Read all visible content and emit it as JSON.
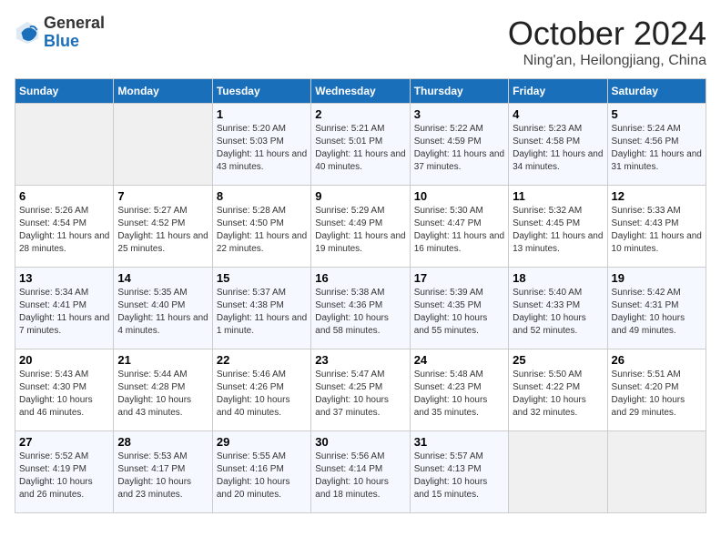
{
  "header": {
    "logo_general": "General",
    "logo_blue": "Blue",
    "month": "October 2024",
    "location": "Ning'an, Heilongjiang, China"
  },
  "days_of_week": [
    "Sunday",
    "Monday",
    "Tuesday",
    "Wednesday",
    "Thursday",
    "Friday",
    "Saturday"
  ],
  "weeks": [
    [
      {
        "day": "",
        "sunrise": "",
        "sunset": "",
        "daylight": ""
      },
      {
        "day": "",
        "sunrise": "",
        "sunset": "",
        "daylight": ""
      },
      {
        "day": "1",
        "sunrise": "Sunrise: 5:20 AM",
        "sunset": "Sunset: 5:03 PM",
        "daylight": "Daylight: 11 hours and 43 minutes."
      },
      {
        "day": "2",
        "sunrise": "Sunrise: 5:21 AM",
        "sunset": "Sunset: 5:01 PM",
        "daylight": "Daylight: 11 hours and 40 minutes."
      },
      {
        "day": "3",
        "sunrise": "Sunrise: 5:22 AM",
        "sunset": "Sunset: 4:59 PM",
        "daylight": "Daylight: 11 hours and 37 minutes."
      },
      {
        "day": "4",
        "sunrise": "Sunrise: 5:23 AM",
        "sunset": "Sunset: 4:58 PM",
        "daylight": "Daylight: 11 hours and 34 minutes."
      },
      {
        "day": "5",
        "sunrise": "Sunrise: 5:24 AM",
        "sunset": "Sunset: 4:56 PM",
        "daylight": "Daylight: 11 hours and 31 minutes."
      }
    ],
    [
      {
        "day": "6",
        "sunrise": "Sunrise: 5:26 AM",
        "sunset": "Sunset: 4:54 PM",
        "daylight": "Daylight: 11 hours and 28 minutes."
      },
      {
        "day": "7",
        "sunrise": "Sunrise: 5:27 AM",
        "sunset": "Sunset: 4:52 PM",
        "daylight": "Daylight: 11 hours and 25 minutes."
      },
      {
        "day": "8",
        "sunrise": "Sunrise: 5:28 AM",
        "sunset": "Sunset: 4:50 PM",
        "daylight": "Daylight: 11 hours and 22 minutes."
      },
      {
        "day": "9",
        "sunrise": "Sunrise: 5:29 AM",
        "sunset": "Sunset: 4:49 PM",
        "daylight": "Daylight: 11 hours and 19 minutes."
      },
      {
        "day": "10",
        "sunrise": "Sunrise: 5:30 AM",
        "sunset": "Sunset: 4:47 PM",
        "daylight": "Daylight: 11 hours and 16 minutes."
      },
      {
        "day": "11",
        "sunrise": "Sunrise: 5:32 AM",
        "sunset": "Sunset: 4:45 PM",
        "daylight": "Daylight: 11 hours and 13 minutes."
      },
      {
        "day": "12",
        "sunrise": "Sunrise: 5:33 AM",
        "sunset": "Sunset: 4:43 PM",
        "daylight": "Daylight: 11 hours and 10 minutes."
      }
    ],
    [
      {
        "day": "13",
        "sunrise": "Sunrise: 5:34 AM",
        "sunset": "Sunset: 4:41 PM",
        "daylight": "Daylight: 11 hours and 7 minutes."
      },
      {
        "day": "14",
        "sunrise": "Sunrise: 5:35 AM",
        "sunset": "Sunset: 4:40 PM",
        "daylight": "Daylight: 11 hours and 4 minutes."
      },
      {
        "day": "15",
        "sunrise": "Sunrise: 5:37 AM",
        "sunset": "Sunset: 4:38 PM",
        "daylight": "Daylight: 11 hours and 1 minute."
      },
      {
        "day": "16",
        "sunrise": "Sunrise: 5:38 AM",
        "sunset": "Sunset: 4:36 PM",
        "daylight": "Daylight: 10 hours and 58 minutes."
      },
      {
        "day": "17",
        "sunrise": "Sunrise: 5:39 AM",
        "sunset": "Sunset: 4:35 PM",
        "daylight": "Daylight: 10 hours and 55 minutes."
      },
      {
        "day": "18",
        "sunrise": "Sunrise: 5:40 AM",
        "sunset": "Sunset: 4:33 PM",
        "daylight": "Daylight: 10 hours and 52 minutes."
      },
      {
        "day": "19",
        "sunrise": "Sunrise: 5:42 AM",
        "sunset": "Sunset: 4:31 PM",
        "daylight": "Daylight: 10 hours and 49 minutes."
      }
    ],
    [
      {
        "day": "20",
        "sunrise": "Sunrise: 5:43 AM",
        "sunset": "Sunset: 4:30 PM",
        "daylight": "Daylight: 10 hours and 46 minutes."
      },
      {
        "day": "21",
        "sunrise": "Sunrise: 5:44 AM",
        "sunset": "Sunset: 4:28 PM",
        "daylight": "Daylight: 10 hours and 43 minutes."
      },
      {
        "day": "22",
        "sunrise": "Sunrise: 5:46 AM",
        "sunset": "Sunset: 4:26 PM",
        "daylight": "Daylight: 10 hours and 40 minutes."
      },
      {
        "day": "23",
        "sunrise": "Sunrise: 5:47 AM",
        "sunset": "Sunset: 4:25 PM",
        "daylight": "Daylight: 10 hours and 37 minutes."
      },
      {
        "day": "24",
        "sunrise": "Sunrise: 5:48 AM",
        "sunset": "Sunset: 4:23 PM",
        "daylight": "Daylight: 10 hours and 35 minutes."
      },
      {
        "day": "25",
        "sunrise": "Sunrise: 5:50 AM",
        "sunset": "Sunset: 4:22 PM",
        "daylight": "Daylight: 10 hours and 32 minutes."
      },
      {
        "day": "26",
        "sunrise": "Sunrise: 5:51 AM",
        "sunset": "Sunset: 4:20 PM",
        "daylight": "Daylight: 10 hours and 29 minutes."
      }
    ],
    [
      {
        "day": "27",
        "sunrise": "Sunrise: 5:52 AM",
        "sunset": "Sunset: 4:19 PM",
        "daylight": "Daylight: 10 hours and 26 minutes."
      },
      {
        "day": "28",
        "sunrise": "Sunrise: 5:53 AM",
        "sunset": "Sunset: 4:17 PM",
        "daylight": "Daylight: 10 hours and 23 minutes."
      },
      {
        "day": "29",
        "sunrise": "Sunrise: 5:55 AM",
        "sunset": "Sunset: 4:16 PM",
        "daylight": "Daylight: 10 hours and 20 minutes."
      },
      {
        "day": "30",
        "sunrise": "Sunrise: 5:56 AM",
        "sunset": "Sunset: 4:14 PM",
        "daylight": "Daylight: 10 hours and 18 minutes."
      },
      {
        "day": "31",
        "sunrise": "Sunrise: 5:57 AM",
        "sunset": "Sunset: 4:13 PM",
        "daylight": "Daylight: 10 hours and 15 minutes."
      },
      {
        "day": "",
        "sunrise": "",
        "sunset": "",
        "daylight": ""
      },
      {
        "day": "",
        "sunrise": "",
        "sunset": "",
        "daylight": ""
      }
    ]
  ]
}
